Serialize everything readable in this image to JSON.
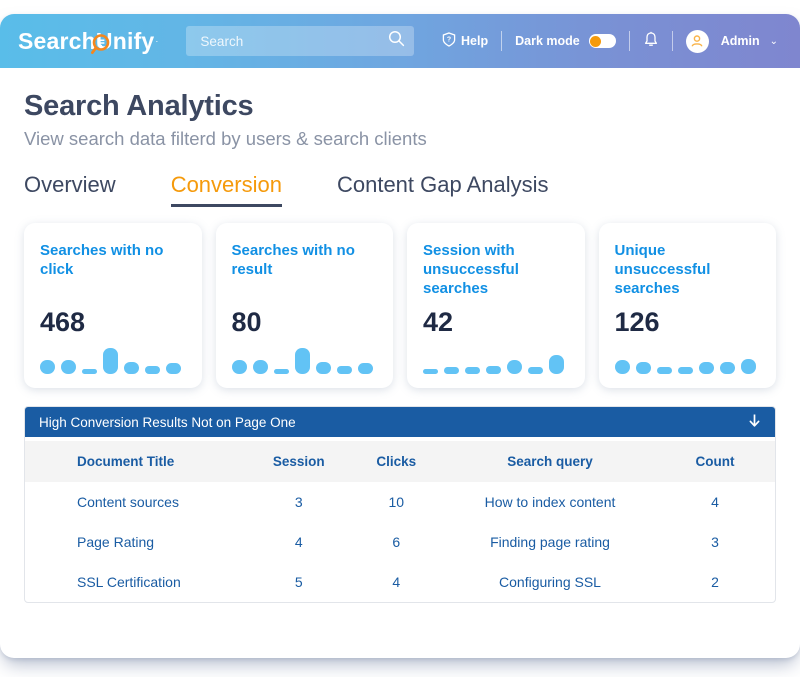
{
  "header": {
    "logo_text": "SearchUnify",
    "logo_mark": "magnifier-icon",
    "logo_trademark": "·",
    "search": {
      "value": "",
      "placeholder": "Search",
      "icon": "search-icon"
    },
    "help_label": "Help",
    "help_icon": "help-shield-icon",
    "dark_mode_label": "Dark mode",
    "dark_mode_on": false,
    "notifications_icon": "bell-icon",
    "user_label": "Admin",
    "user_icon": "user-avatar-icon",
    "user_caret": "⌄"
  },
  "page": {
    "title": "Search Analytics",
    "subtitle": "View search data filterd by users & search clients"
  },
  "tabs": [
    {
      "label": "Overview",
      "active": false
    },
    {
      "label": "Conversion",
      "active": true
    },
    {
      "label": "Content Gap Analysis",
      "active": false
    }
  ],
  "cards": [
    {
      "title": "Searches with no click",
      "value": "468",
      "spark": [
        14,
        14,
        5,
        26,
        12,
        8,
        11
      ]
    },
    {
      "title": "Searches with no result",
      "value": "80",
      "spark": [
        14,
        14,
        5,
        26,
        12,
        8,
        11
      ]
    },
    {
      "title": "Session with unsuccessful searches",
      "value": "42",
      "spark": [
        5,
        7,
        7,
        8,
        14,
        7,
        19
      ]
    },
    {
      "title": "Unique unsuccessful searches",
      "value": "126",
      "spark": [
        14,
        12,
        7,
        7,
        12,
        12,
        15
      ]
    }
  ],
  "panel": {
    "title": "High Conversion Results Not on Page One",
    "arrow_icon": "arrow-down-icon",
    "columns": [
      "Document Title",
      "Session",
      "Clicks",
      "Search query",
      "Count"
    ],
    "rows": [
      [
        "Content sources",
        "3",
        "10",
        "How to index content",
        "4"
      ],
      [
        "Page Rating",
        "4",
        "6",
        "Finding page rating",
        "3"
      ],
      [
        "SSL Certification",
        "5",
        "4",
        "Configuring SSL",
        "2"
      ]
    ]
  },
  "colors": {
    "brand_orange": "#f59a0b",
    "brand_blue": "#1190e4",
    "panel_blue": "#1a5ca3",
    "navy_text": "#3d4861",
    "spark_blue": "#62c3f5"
  }
}
